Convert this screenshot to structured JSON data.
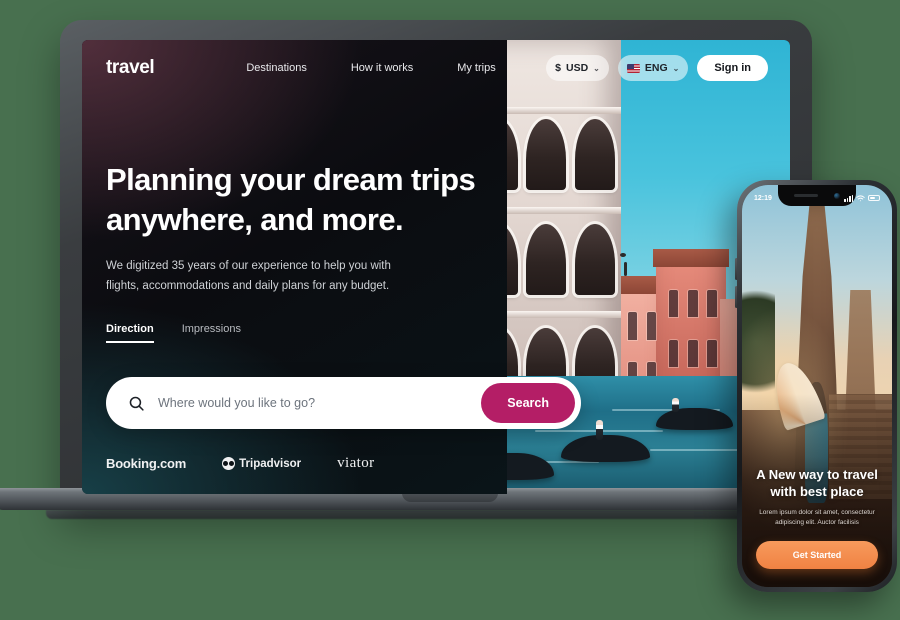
{
  "background_color": "#48704f",
  "laptop": {
    "site": {
      "navbar": {
        "brand": "travel",
        "links": [
          {
            "label": "Destinations"
          },
          {
            "label": "How it works"
          },
          {
            "label": "My trips"
          }
        ],
        "currency": {
          "symbol": "$",
          "label": "USD",
          "chevron": "⌄"
        },
        "language": {
          "label": "ENG",
          "chevron": "⌄",
          "flag": "us-flag-icon"
        },
        "signin_label": "Sign in"
      },
      "hero": {
        "title_line1": "Planning your dream trips",
        "title_line2": "anywhere, and more.",
        "subtitle_line1": "We digitized 35 years of our experience to help you with",
        "subtitle_line2": "flights, accommodations and daily plans for any budget.",
        "tabs": [
          {
            "label": "Direction",
            "active": true
          },
          {
            "label": "Impressions",
            "active": false
          }
        ]
      },
      "search": {
        "icon": "search-icon",
        "placeholder": "Where would you like to go?",
        "value": "",
        "button_label": "Search",
        "button_color": "#b41e66"
      },
      "partners": [
        {
          "name": "Booking.com"
        },
        {
          "name": "Tripadvisor",
          "icon": "owl-icon"
        },
        {
          "name": "viator"
        }
      ],
      "photo_alt": "venice-canal-gondolas"
    }
  },
  "phone": {
    "status": {
      "time": "12:19",
      "signal": "signal-icon",
      "wifi": "wifi-icon",
      "battery": "battery-icon"
    },
    "content": {
      "title_line1": "A New way to travel",
      "title_line2": "with best place",
      "subtitle_line1": "Lorem ipsum dolor sit amet, consectetur",
      "subtitle_line2": "adipiscing elit. Auctor facilisis",
      "button_label": "Get Started",
      "button_color": "#f08243"
    },
    "photo_alt": "temple-woman-parasol"
  }
}
